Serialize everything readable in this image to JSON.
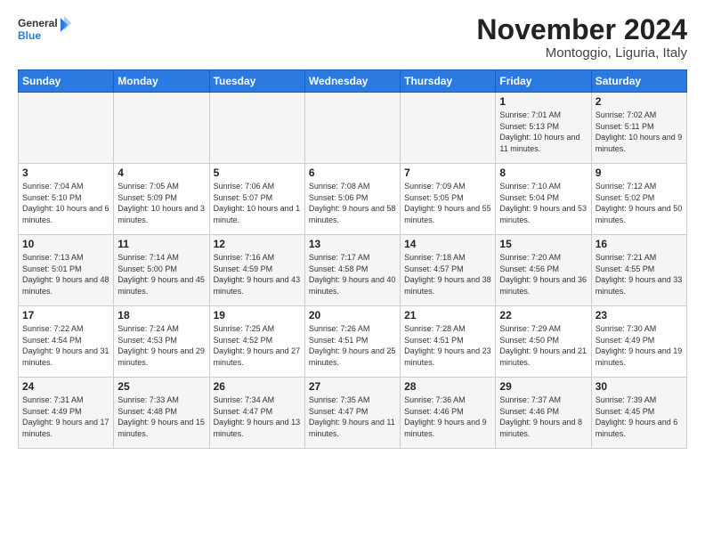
{
  "logo": {
    "line1": "General",
    "line2": "Blue"
  },
  "title": "November 2024",
  "subtitle": "Montoggio, Liguria, Italy",
  "header_days": [
    "Sunday",
    "Monday",
    "Tuesday",
    "Wednesday",
    "Thursday",
    "Friday",
    "Saturday"
  ],
  "weeks": [
    [
      {
        "day": "",
        "info": ""
      },
      {
        "day": "",
        "info": ""
      },
      {
        "day": "",
        "info": ""
      },
      {
        "day": "",
        "info": ""
      },
      {
        "day": "",
        "info": ""
      },
      {
        "day": "1",
        "info": "Sunrise: 7:01 AM\nSunset: 5:13 PM\nDaylight: 10 hours and 11 minutes."
      },
      {
        "day": "2",
        "info": "Sunrise: 7:02 AM\nSunset: 5:11 PM\nDaylight: 10 hours and 9 minutes."
      }
    ],
    [
      {
        "day": "3",
        "info": "Sunrise: 7:04 AM\nSunset: 5:10 PM\nDaylight: 10 hours and 6 minutes."
      },
      {
        "day": "4",
        "info": "Sunrise: 7:05 AM\nSunset: 5:09 PM\nDaylight: 10 hours and 3 minutes."
      },
      {
        "day": "5",
        "info": "Sunrise: 7:06 AM\nSunset: 5:07 PM\nDaylight: 10 hours and 1 minute."
      },
      {
        "day": "6",
        "info": "Sunrise: 7:08 AM\nSunset: 5:06 PM\nDaylight: 9 hours and 58 minutes."
      },
      {
        "day": "7",
        "info": "Sunrise: 7:09 AM\nSunset: 5:05 PM\nDaylight: 9 hours and 55 minutes."
      },
      {
        "day": "8",
        "info": "Sunrise: 7:10 AM\nSunset: 5:04 PM\nDaylight: 9 hours and 53 minutes."
      },
      {
        "day": "9",
        "info": "Sunrise: 7:12 AM\nSunset: 5:02 PM\nDaylight: 9 hours and 50 minutes."
      }
    ],
    [
      {
        "day": "10",
        "info": "Sunrise: 7:13 AM\nSunset: 5:01 PM\nDaylight: 9 hours and 48 minutes."
      },
      {
        "day": "11",
        "info": "Sunrise: 7:14 AM\nSunset: 5:00 PM\nDaylight: 9 hours and 45 minutes."
      },
      {
        "day": "12",
        "info": "Sunrise: 7:16 AM\nSunset: 4:59 PM\nDaylight: 9 hours and 43 minutes."
      },
      {
        "day": "13",
        "info": "Sunrise: 7:17 AM\nSunset: 4:58 PM\nDaylight: 9 hours and 40 minutes."
      },
      {
        "day": "14",
        "info": "Sunrise: 7:18 AM\nSunset: 4:57 PM\nDaylight: 9 hours and 38 minutes."
      },
      {
        "day": "15",
        "info": "Sunrise: 7:20 AM\nSunset: 4:56 PM\nDaylight: 9 hours and 36 minutes."
      },
      {
        "day": "16",
        "info": "Sunrise: 7:21 AM\nSunset: 4:55 PM\nDaylight: 9 hours and 33 minutes."
      }
    ],
    [
      {
        "day": "17",
        "info": "Sunrise: 7:22 AM\nSunset: 4:54 PM\nDaylight: 9 hours and 31 minutes."
      },
      {
        "day": "18",
        "info": "Sunrise: 7:24 AM\nSunset: 4:53 PM\nDaylight: 9 hours and 29 minutes."
      },
      {
        "day": "19",
        "info": "Sunrise: 7:25 AM\nSunset: 4:52 PM\nDaylight: 9 hours and 27 minutes."
      },
      {
        "day": "20",
        "info": "Sunrise: 7:26 AM\nSunset: 4:51 PM\nDaylight: 9 hours and 25 minutes."
      },
      {
        "day": "21",
        "info": "Sunrise: 7:28 AM\nSunset: 4:51 PM\nDaylight: 9 hours and 23 minutes."
      },
      {
        "day": "22",
        "info": "Sunrise: 7:29 AM\nSunset: 4:50 PM\nDaylight: 9 hours and 21 minutes."
      },
      {
        "day": "23",
        "info": "Sunrise: 7:30 AM\nSunset: 4:49 PM\nDaylight: 9 hours and 19 minutes."
      }
    ],
    [
      {
        "day": "24",
        "info": "Sunrise: 7:31 AM\nSunset: 4:49 PM\nDaylight: 9 hours and 17 minutes."
      },
      {
        "day": "25",
        "info": "Sunrise: 7:33 AM\nSunset: 4:48 PM\nDaylight: 9 hours and 15 minutes."
      },
      {
        "day": "26",
        "info": "Sunrise: 7:34 AM\nSunset: 4:47 PM\nDaylight: 9 hours and 13 minutes."
      },
      {
        "day": "27",
        "info": "Sunrise: 7:35 AM\nSunset: 4:47 PM\nDaylight: 9 hours and 11 minutes."
      },
      {
        "day": "28",
        "info": "Sunrise: 7:36 AM\nSunset: 4:46 PM\nDaylight: 9 hours and 9 minutes."
      },
      {
        "day": "29",
        "info": "Sunrise: 7:37 AM\nSunset: 4:46 PM\nDaylight: 9 hours and 8 minutes."
      },
      {
        "day": "30",
        "info": "Sunrise: 7:39 AM\nSunset: 4:45 PM\nDaylight: 9 hours and 6 minutes."
      }
    ]
  ]
}
